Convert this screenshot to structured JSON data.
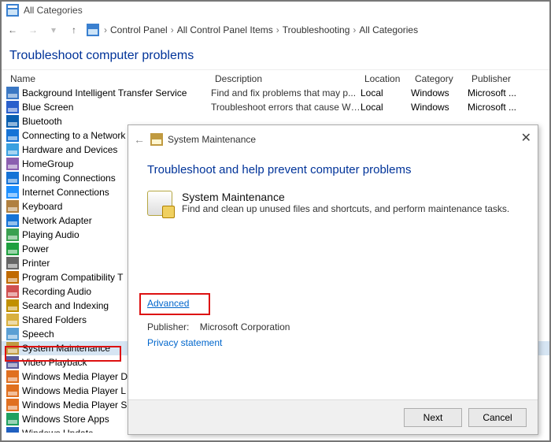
{
  "window": {
    "title": "All Categories"
  },
  "breadcrumb": {
    "items": [
      "Control Panel",
      "All Control Panel Items",
      "Troubleshooting",
      "All Categories"
    ]
  },
  "heading": "Troubleshoot computer problems",
  "columns": {
    "name": "Name",
    "desc": "Description",
    "loc": "Location",
    "cat": "Category",
    "pub": "Publisher"
  },
  "items": [
    {
      "name": "Background Intelligent Transfer Service",
      "desc": "Find and fix problems that may p...",
      "loc": "Local",
      "cat": "Windows",
      "pub": "Microsoft ...",
      "color": "#3b78c4"
    },
    {
      "name": "Blue Screen",
      "desc": "Troubleshoot errors that cause Wi...",
      "loc": "Local",
      "cat": "Windows",
      "pub": "Microsoft ...",
      "color": "#2a5fcc"
    },
    {
      "name": "Bluetooth",
      "color": "#0a5fb0"
    },
    {
      "name": "Connecting to a Network",
      "color": "#1573d6"
    },
    {
      "name": "Hardware and Devices",
      "color": "#3aa0e0"
    },
    {
      "name": "HomeGroup",
      "color": "#8b5fb0"
    },
    {
      "name": "Incoming Connections",
      "color": "#1573d6"
    },
    {
      "name": "Internet Connections",
      "color": "#1e90ff"
    },
    {
      "name": "Keyboard",
      "color": "#b08040"
    },
    {
      "name": "Network Adapter",
      "color": "#1573d6"
    },
    {
      "name": "Playing Audio",
      "color": "#3aa050"
    },
    {
      "name": "Power",
      "color": "#20a040"
    },
    {
      "name": "Printer",
      "color": "#666666"
    },
    {
      "name": "Program Compatibility T",
      "color": "#c06a00"
    },
    {
      "name": "Recording Audio",
      "color": "#d05050"
    },
    {
      "name": "Search and Indexing",
      "color": "#c09000"
    },
    {
      "name": "Shared Folders",
      "color": "#d8b040"
    },
    {
      "name": "Speech",
      "color": "#5a9fd4"
    },
    {
      "name": "System Maintenance",
      "selected": true,
      "color": "#c09a40"
    },
    {
      "name": "Video Playback",
      "color": "#5a5a9a"
    },
    {
      "name": "Windows Media Player D",
      "color": "#e07020"
    },
    {
      "name": "Windows Media Player L",
      "color": "#e07020"
    },
    {
      "name": "Windows Media Player S",
      "color": "#e07020"
    },
    {
      "name": "Windows Store Apps",
      "color": "#20a060"
    },
    {
      "name": "Windows Update",
      "color": "#2060c0"
    }
  ],
  "wizard": {
    "title": "System Maintenance",
    "h1": "Troubleshoot and help prevent computer problems",
    "item_title": "System Maintenance",
    "item_desc": "Find and clean up unused files and shortcuts, and perform maintenance tasks.",
    "advanced": "Advanced",
    "publisher_label": "Publisher:",
    "publisher_value": "Microsoft Corporation",
    "privacy": "Privacy statement",
    "next": "Next",
    "cancel": "Cancel"
  }
}
